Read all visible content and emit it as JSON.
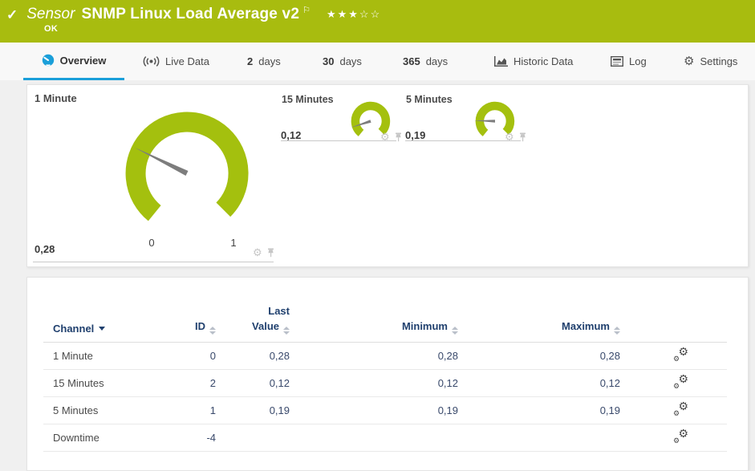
{
  "colors": {
    "brand_green": "#a8bc0f",
    "gauge_green": "#a4c00e",
    "accent_blue": "#1a9fd9",
    "table_header_navy": "#20406e",
    "value_text_navy": "#39496b",
    "status_text": "#ffffff"
  },
  "icons": {
    "check": "✓",
    "flag": "⚐",
    "gear": "⚙"
  },
  "header": {
    "type_label": "Sensor",
    "title": "SNMP Linux Load Average v2",
    "status": "OK",
    "rating_stars": "★★★☆☆"
  },
  "tabs": [
    {
      "label": "Overview",
      "active": true
    },
    {
      "label": "Live Data"
    },
    {
      "num": "2",
      "label": "days"
    },
    {
      "num": "30",
      "label": "days"
    },
    {
      "num": "365",
      "label": "days"
    },
    {
      "label": "Historic Data"
    },
    {
      "label": "Log"
    },
    {
      "label": "Settings"
    }
  ],
  "gauges": [
    {
      "name": "1 Minute",
      "value": "0,28",
      "value_num": 0.28,
      "scale_min": "0",
      "scale_max": "1"
    },
    {
      "name": "15 Minutes",
      "value": "0,12",
      "value_num": 0.12
    },
    {
      "name": "5 Minutes",
      "value": "0,19",
      "value_num": 0.19
    }
  ],
  "table": {
    "headers": {
      "channel": "Channel",
      "id": "ID",
      "last_line1": "Last",
      "last_line2": "Value",
      "minimum": "Minimum",
      "maximum": "Maximum"
    },
    "rows": [
      {
        "channel": "1 Minute",
        "id": "0",
        "last": "0,28",
        "min": "0,28",
        "max": "0,28"
      },
      {
        "channel": "15 Minutes",
        "id": "2",
        "last": "0,12",
        "min": "0,12",
        "max": "0,12"
      },
      {
        "channel": "5 Minutes",
        "id": "1",
        "last": "0,19",
        "min": "0,19",
        "max": "0,19"
      },
      {
        "channel": "Downtime",
        "id": "-4",
        "last": "",
        "min": "",
        "max": ""
      }
    ]
  }
}
